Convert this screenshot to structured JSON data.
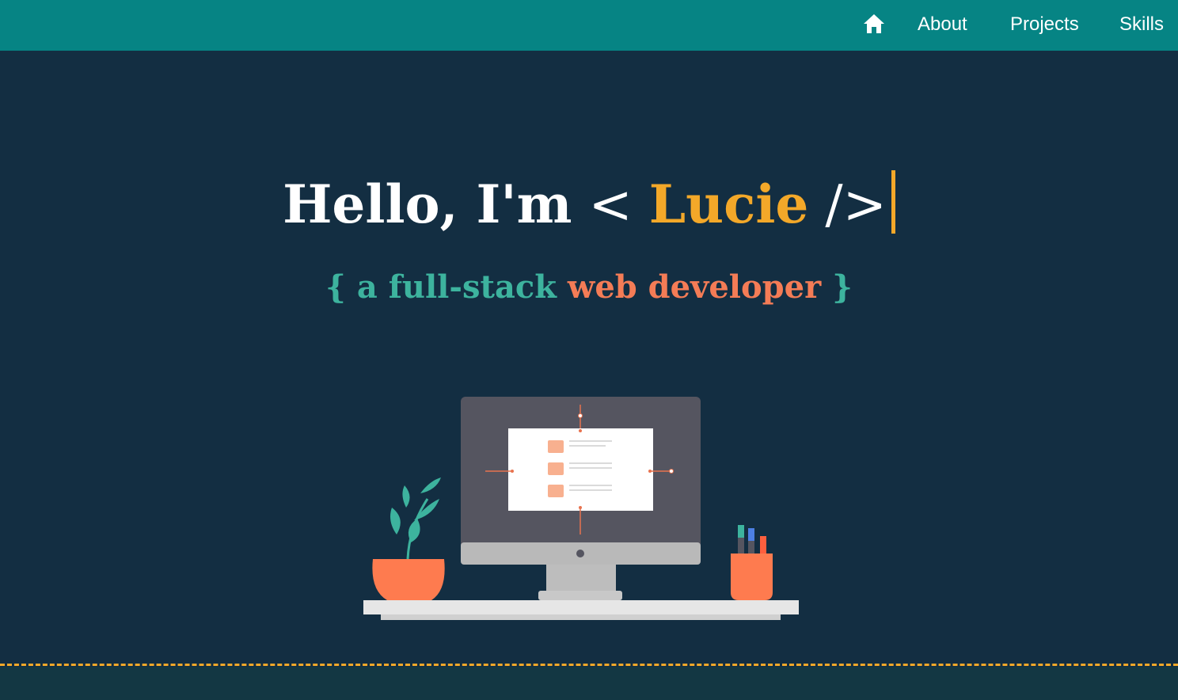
{
  "nav": {
    "home_icon": "home-icon",
    "links": {
      "about": "About",
      "projects": "Projects",
      "skills": "Skills"
    }
  },
  "hero": {
    "greeting": "Hello, I'm",
    "tag_open": "<",
    "name": "Lucie",
    "tag_close": "/>",
    "subtitle": {
      "brace_open": "{",
      "teal_text": "a full-stack",
      "orange_text": "web developer",
      "brace_close": "}"
    }
  },
  "colors": {
    "navbar": "#068484",
    "background": "#132e42",
    "accent_yellow": "#f3a829",
    "teal": "#3db39e",
    "orange": "#f47c56"
  }
}
